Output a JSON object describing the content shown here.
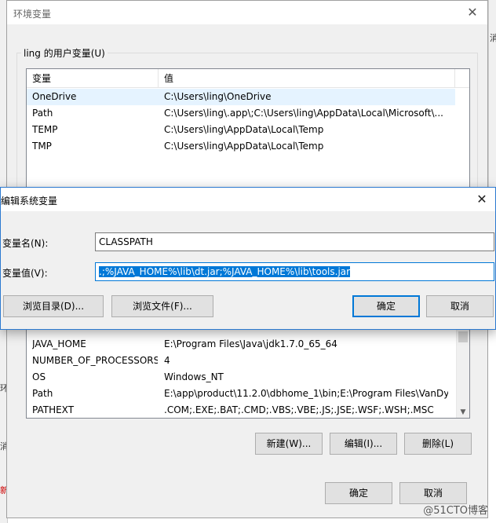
{
  "env_window": {
    "title": "环境变量",
    "user_group_label": "ling 的用户变量(U)",
    "user_list": {
      "headers": [
        "变量",
        "值"
      ],
      "rows": [
        {
          "name": "OneDrive",
          "value": "C:\\Users\\ling\\OneDrive",
          "selected": true
        },
        {
          "name": "Path",
          "value": "C:\\Users\\ling\\.app\\;C:\\Users\\ling\\AppData\\Local\\Microsoft\\...",
          "selected": false
        },
        {
          "name": "TEMP",
          "value": "C:\\Users\\ling\\AppData\\Local\\Temp",
          "selected": false
        },
        {
          "name": "TMP",
          "value": "C:\\Users\\ling\\AppData\\Local\\Temp",
          "selected": false
        }
      ]
    },
    "sys_list": {
      "rows": [
        {
          "name": "JAVA_HOME",
          "value": "E:\\Program Files\\Java\\jdk1.7.0_65_64"
        },
        {
          "name": "NUMBER_OF_PROCESSORS",
          "value": "4"
        },
        {
          "name": "OS",
          "value": "Windows_NT"
        },
        {
          "name": "Path",
          "value": "E:\\app\\product\\11.2.0\\dbhome_1\\bin;E:\\Program Files\\VanDy..."
        },
        {
          "name": "PATHEXT",
          "value": ".COM;.EXE;.BAT;.CMD;.VBS;.VBE;.JS;.JSE;.WSF;.WSH;.MSC"
        }
      ]
    },
    "sys_buttons": {
      "new": "新建(W)...",
      "edit": "编辑(I)...",
      "delete": "删除(L)"
    },
    "footer_buttons": {
      "ok": "确定",
      "cancel": "取消"
    }
  },
  "edit_dialog": {
    "title": "编辑系统变量",
    "name_label": "变量名(N):",
    "name_value": "CLASSPATH",
    "value_label": "变量值(V):",
    "value_value": ".;%JAVA_HOME%\\lib\\dt.jar;%JAVA_HOME%\\lib\\tools.jar",
    "buttons": {
      "browse_dir": "浏览目录(D)...",
      "browse_file": "浏览文件(F)...",
      "ok": "确定",
      "cancel": "取消"
    }
  },
  "background": {
    "right_peek": "消",
    "left_peek_1": "环",
    "left_peek_2": "消",
    "left_peek_3": "新"
  },
  "watermark": "@51CTO博客",
  "colors": {
    "accent": "#0078d7",
    "selected_row": "#e5f3ff",
    "window_bg": "#f0f0f0"
  }
}
